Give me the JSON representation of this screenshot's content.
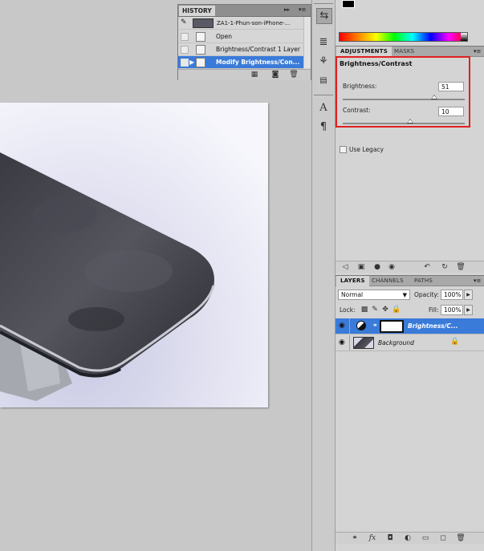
{
  "history": {
    "tab": "HISTORY",
    "ctrl_forward": "▸▸",
    "ctrl_menu": "▾≡",
    "snapshot_label": "ZA1-1-Phun-son-iPhone-...",
    "items": [
      {
        "label": "Open"
      },
      {
        "label": "Brightness/Contrast 1 Layer"
      },
      {
        "label": "Modify Brightness/Con..."
      }
    ]
  },
  "adjustments": {
    "tabs": [
      "ADJUSTMENTS",
      "MASKS"
    ],
    "title": "Brightness/Contrast",
    "brightness_label": "Brightness:",
    "brightness_value": "51",
    "brightness_level": 0.75,
    "contrast_label": "Contrast:",
    "contrast_value": "10",
    "contrast_level": 0.55,
    "use_legacy_label": "Use Legacy",
    "use_legacy_checked": false
  },
  "layers": {
    "tabs": [
      "LAYERS",
      "CHANNELS",
      "PATHS"
    ],
    "blend_mode": "Normal",
    "opacity_label": "Opacity:",
    "opacity_value": "100%",
    "lock_label": "Lock:",
    "fill_label": "Fill:",
    "fill_value": "100%",
    "rows": [
      {
        "name": "Brightness/C...",
        "selected": true
      },
      {
        "name": "Background",
        "selected": false
      }
    ]
  },
  "colors": {
    "accent_selected": "#3a7bd9",
    "highlight_box": "#e02020"
  }
}
